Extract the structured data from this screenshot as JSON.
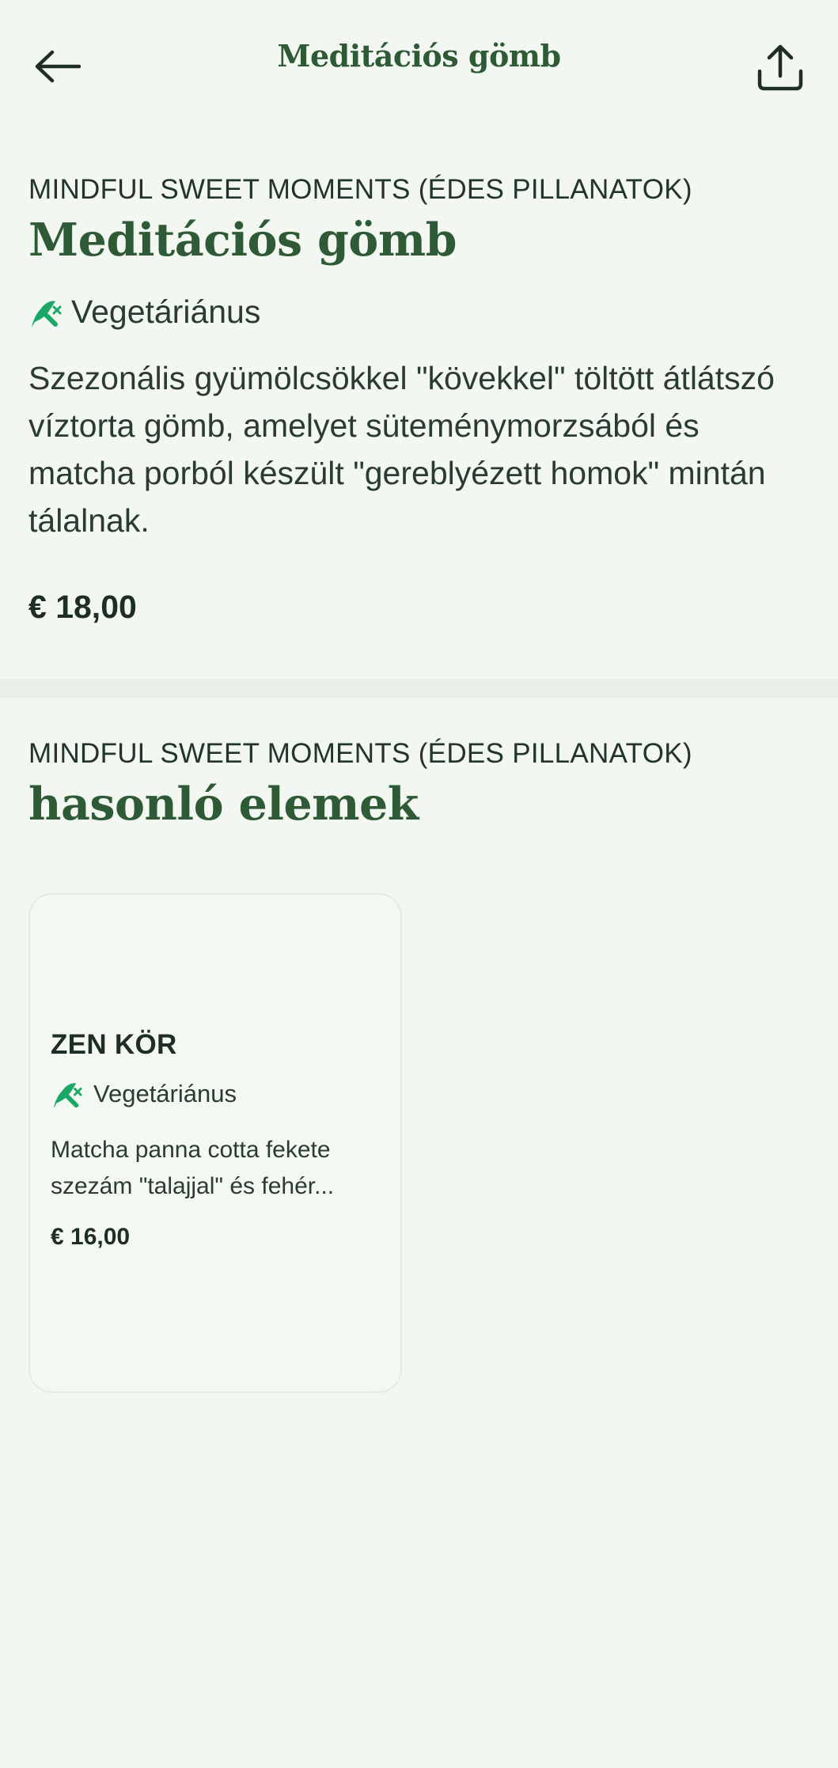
{
  "topbar": {
    "title": "Meditációs gömb",
    "back_icon": "arrow-left-icon",
    "share_icon": "share-icon"
  },
  "item": {
    "category": "MINDFUL SWEET MOMENTS (ÉDES PILLANATOK)",
    "name": "Meditációs gömb",
    "diet_label": "Vegetáriánus",
    "diet_icon": "vegetarian-leaf-icon",
    "description": "Szezonális gyümölcsökkel \"kövekkel\" töltött átlátszó víztorta gömb, amelyet süteménymorzsából és matcha porból készült \"gereblyézett homok\" mintán tálalnak.",
    "price": "€ 18,00"
  },
  "similar": {
    "category": "MINDFUL SWEET MOMENTS (ÉDES PILLANATOK)",
    "heading": "hasonló elemek",
    "items": [
      {
        "name": "ZEN KÖR",
        "diet_label": "Vegetáriánus",
        "description_line1": "Matcha panna cotta fekete",
        "description_line2": "szezám \"talajjal\" és fehér...",
        "price": "€ 16,00"
      }
    ]
  },
  "colors": {
    "background": "#f3f7f2",
    "accent_green": "#2f5a36",
    "icon_green": "#1aa866",
    "text_dark": "#1f2e24"
  }
}
